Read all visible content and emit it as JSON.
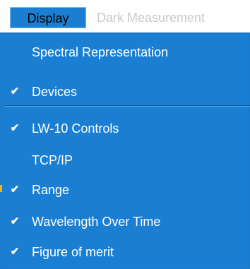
{
  "menubar": {
    "items": [
      {
        "label": "Display"
      },
      {
        "label": "Dark Measurement"
      }
    ]
  },
  "dropdown": {
    "items": [
      {
        "label": "Spectral Representation",
        "checked": false
      },
      {
        "label": "Devices",
        "checked": true
      },
      {
        "label": "LW-10 Controls",
        "checked": true
      },
      {
        "label": "TCP/IP",
        "checked": false
      },
      {
        "label": "Range",
        "checked": true
      },
      {
        "label": "Wavelength Over Time",
        "checked": true
      },
      {
        "label": "Figure of merit",
        "checked": true
      }
    ]
  },
  "colors": {
    "menu_bg": "#1a7fd3",
    "menu_text": "#ffffff",
    "inactive_text": "#c9c9c9"
  },
  "icons": {
    "check": "check-icon"
  }
}
